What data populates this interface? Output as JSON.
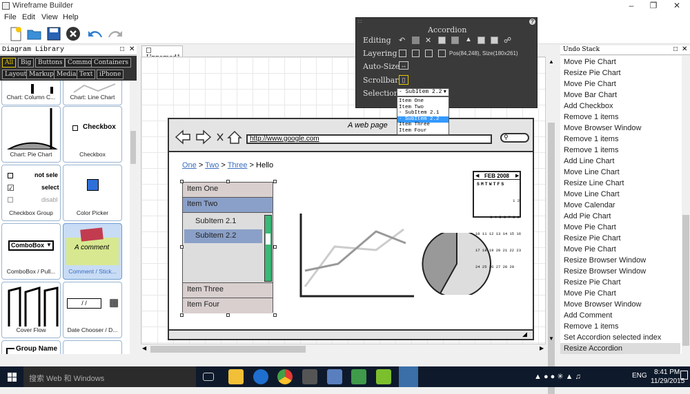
{
  "window": {
    "title": "Wireframe Builder"
  },
  "menu": [
    "File",
    "Edit",
    "View",
    "Help"
  ],
  "left_panel": {
    "title": "Diagram Library",
    "filters": [
      "All",
      "Big",
      "Buttons",
      "Common",
      "Containers",
      "Layout",
      "Markup",
      "Media",
      "Text",
      "iPhone"
    ],
    "items": [
      {
        "caption": "Chart: Column C..."
      },
      {
        "caption": "Chart: Line Chart"
      },
      {
        "caption": "Chart: Pie Chart"
      },
      {
        "caption": "Checkbox",
        "label": "Checkbox"
      },
      {
        "caption": "Checkbox Group",
        "options": [
          "not sele",
          "select",
          "disabl"
        ]
      },
      {
        "caption": "Color Picker"
      },
      {
        "caption": "ComboBox / Pull...",
        "label": "ComboBox"
      },
      {
        "caption": "Comment / Stick...",
        "label": "A comment"
      },
      {
        "caption": "Cover Flow"
      },
      {
        "caption": "Date Chooser / D...",
        "label": "/ /"
      },
      {
        "caption": "",
        "label": "Group Name"
      }
    ]
  },
  "tab": {
    "label": "Unnamed1"
  },
  "wireframe": {
    "browser_title": "A web page",
    "url": "http://www.google.com",
    "breadcrumb": {
      "links": [
        "One",
        "Two",
        "Three"
      ],
      "current": "Hello",
      "sep": ">"
    },
    "accordion": {
      "items": [
        "Item One",
        "Item Two",
        "Item Three",
        "Item Four"
      ],
      "subitems": [
        "SubItem 2.1",
        "SubItem 2.2"
      ]
    },
    "calendar": {
      "month": "FEB 2008",
      "days": "SMTWTFS",
      "rows": [
        "            1 2",
        "3 4 5 6 7 8 9",
        "10 11 12 13 14 15 16",
        "17 18 19 20 21 22 23",
        "24 25 26 27 28 29"
      ]
    }
  },
  "float_panel": {
    "title": "Accordion",
    "labels": [
      "Editing",
      "Layering",
      "Auto-Size",
      "Scrollbar",
      "Selection"
    ],
    "pos_size": "Pos(84,248), Size(180x261)",
    "selection_value": "- SubItem 2.2",
    "dropdown": [
      "Item One",
      "Item Two",
      "- SubItem 2.1",
      "- SubItem 2.2",
      "Item Three",
      "Item Four"
    ]
  },
  "undo_stack": {
    "title": "Undo Stack",
    "items": [
      "Move Pie Chart",
      "Resize Pie Chart",
      "Move Pie Chart",
      "Move Bar Chart",
      "Add Checkbox",
      "Remove 1 items",
      "Move Browser Window",
      "Remove 1 items",
      "Remove 1 items",
      "Add Line Chart",
      "Move Line Chart",
      "Resize Line Chart",
      "Move Line Chart",
      "Move Calendar",
      "Add Pie Chart",
      "Move Pie Chart",
      "Resize Pie Chart",
      "Move Pie Chart",
      "Resize Browser Window",
      "Resize Browser Window",
      "Resize Pie Chart",
      "Move Pie Chart",
      "Move Browser Window",
      "Add Comment",
      "Remove 1 items",
      "Set Accordion selected index",
      "Resize Accordion"
    ]
  },
  "taskbar": {
    "search_placeholder": "搜索 Web 和 Windows",
    "time": "8:41 PM",
    "date": "11/29/2015",
    "lang": "ENG"
  },
  "colors": {
    "accent": "#8aa0c8",
    "panel_dark": "#3a3a3a",
    "filter_on": "#e6c800"
  }
}
